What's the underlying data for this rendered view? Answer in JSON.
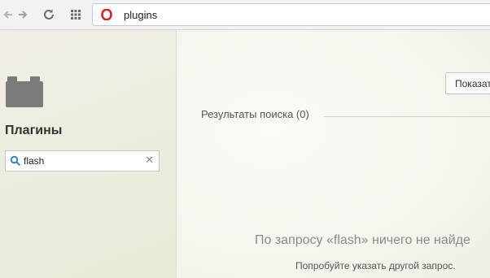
{
  "browser": {
    "url": "plugins",
    "icons": {
      "back": "back-arrow-icon",
      "forward": "forward-arrow-icon",
      "reload": "reload-icon",
      "speed_dial": "grid-icon",
      "logo": "opera-logo-icon"
    },
    "accent_color": "#e0202b"
  },
  "sidebar": {
    "title": "Плагины",
    "icon": "plugin-brick-icon",
    "search": {
      "value": "flash",
      "icon": "search-icon",
      "clear_icon": "close-icon"
    }
  },
  "main": {
    "show_button_label": "Показат",
    "results_heading": "Результаты поиска (0)",
    "no_results_message": "По запросу «flash» ничего не найде",
    "hint": "Попробуйте указать другой запрос."
  }
}
